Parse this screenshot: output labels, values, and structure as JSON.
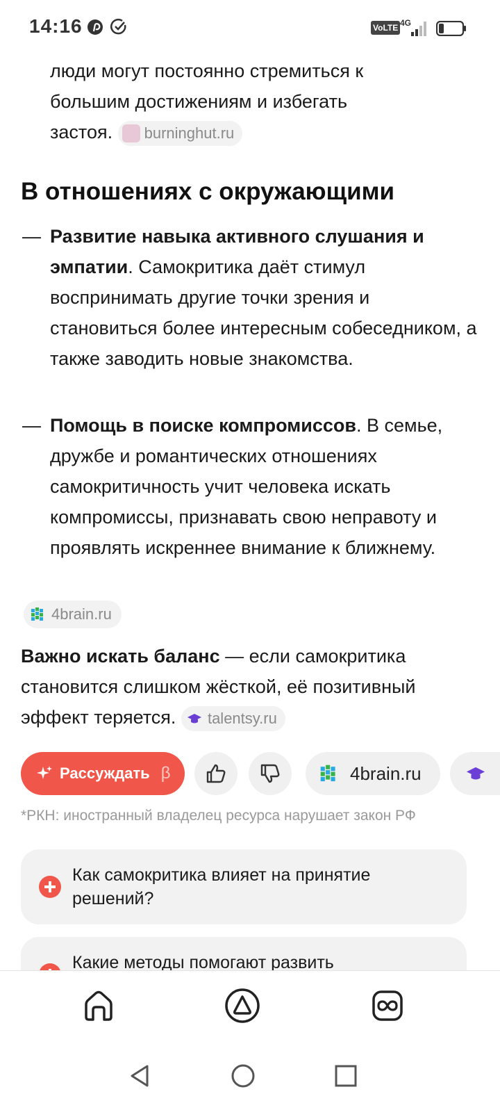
{
  "status_bar": {
    "time": "14:16",
    "volte": "VoLTE",
    "network": "4G"
  },
  "article": {
    "para_intro_lines": [
      "люди могут постоянно стремиться к",
      "большим достижениям и избегать",
      "застоя."
    ],
    "source_burninghut": "burninghut.ru",
    "section_heading": "В отношениях с окружающими",
    "bullet1_bold": "Развитие навыка активного слушания и эмпатии",
    "bullet1_text": ". Самокритика даёт стимул воспринимать другие точки зрения и становиться более интересным собеседником, а также заводить новые знакомства.",
    "bullet2_bold": "Помощь в поиске компромиссов",
    "bullet2_text": ". В семье, дружбе и романтических отношениях самокритичность учит человека искать компромиссы, признавать свою неправоту и проявлять искреннее внимание к ближнему.",
    "source_4brain": "4brain.ru",
    "balance_bold": "Важно искать баланс",
    "balance_text": " — если самокритика становится слишком жёсткой, её позитивный эффект теряется.",
    "source_talentsy": "talentsy.ru",
    "dash": "—"
  },
  "actions": {
    "reason_label": "Рассуждать",
    "beta": "β",
    "source_pill": "4brain.ru"
  },
  "rkn_note": "*РКН: иностранный владелец ресурса нарушает закон РФ",
  "questions": [
    {
      "text": "Как самокритика влияет на принятие решений?"
    },
    {
      "text": "Какие методы помогают развить"
    }
  ],
  "colors": {
    "accent": "#f0574a",
    "chip_bg": "#f2f2f2",
    "muted": "#9a9a9a"
  }
}
